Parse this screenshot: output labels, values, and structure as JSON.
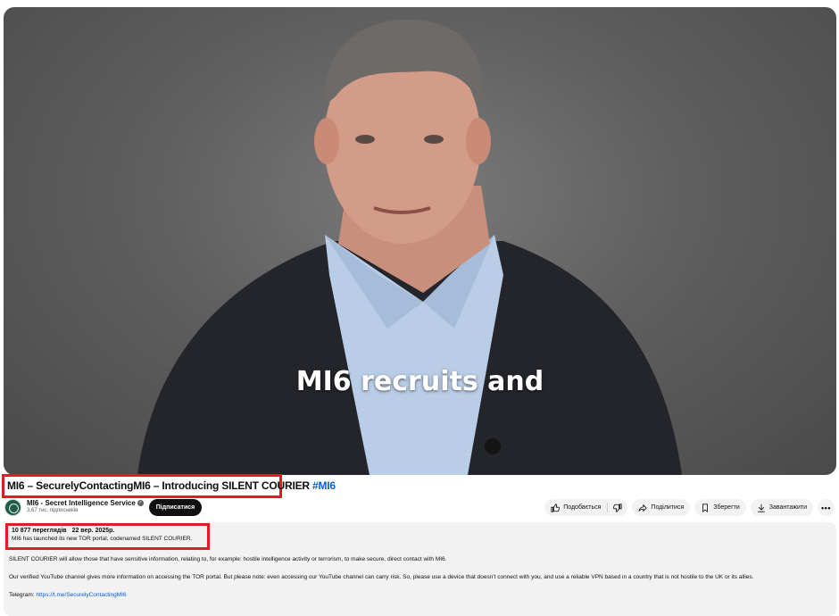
{
  "video": {
    "caption": "MI6 recruits and"
  },
  "title": {
    "text": "MI6 – SecurelyContactingMI6 – Introducing SILENT COURIER",
    "hashtag": "#MI6"
  },
  "channel": {
    "name": "MI6 - Secret Intelligence Service",
    "subscribers": "3,67 тис. підписників",
    "subscribe_label": "Підписатися"
  },
  "actions": {
    "like": "Подобається",
    "share": "Поділитися",
    "save": "Зберегти",
    "download": "Завантажити",
    "more": "•••"
  },
  "description": {
    "views": "10 877 переглядів",
    "date": "22 вер. 2025р.",
    "summary": "MI6 has launched its new TOR portal, codenamed SILENT COURIER.",
    "para1": "SILENT COURIER will allow those that have sensitive information, relating to, for example: hostile intelligence activity or terrorism, to make secure, direct contact with MI6.",
    "para2": "Our verified YouTube channel gives more information on accessing the TOR portal. But please note: even accessing our YouTube channel can carry risk. So, please use a device that doesn't connect with you, and use a reliable VPN based in a country that is not hostile to the UK or its allies.",
    "telegram_label": "Telegram:",
    "telegram_link": "https://t.me/SecurelyContactingMI6"
  },
  "colors": {
    "highlight_border": "#e31b23",
    "link": "#065fd4",
    "subscribe_bg": "#0f0f0f"
  }
}
